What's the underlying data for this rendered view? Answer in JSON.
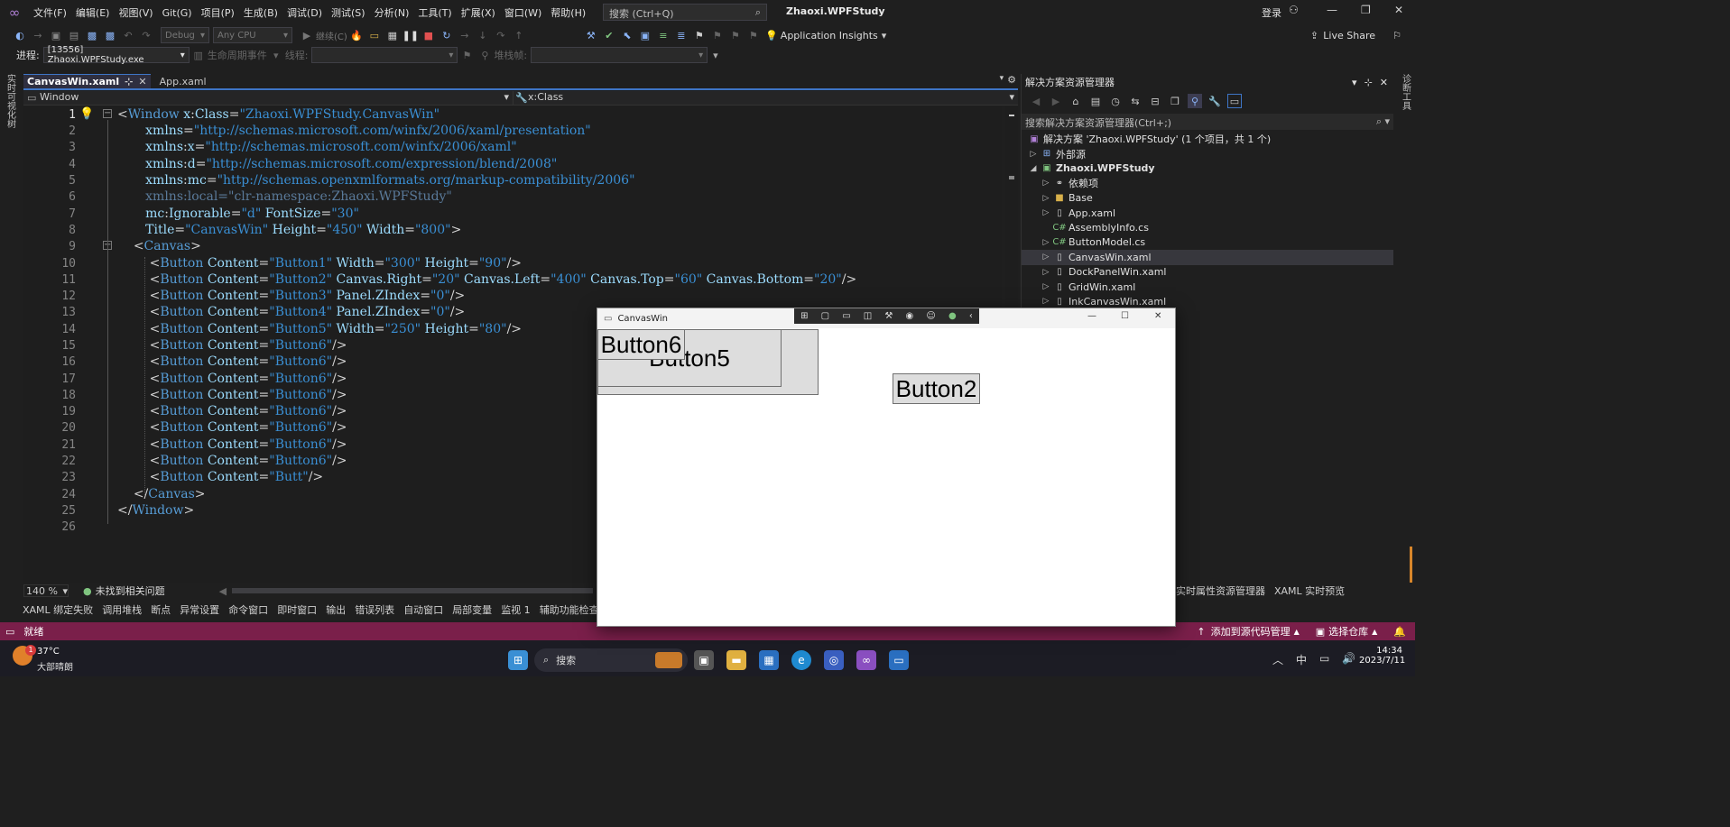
{
  "menubar": {
    "items": [
      "文件(F)",
      "编辑(E)",
      "视图(V)",
      "Git(G)",
      "项目(P)",
      "生成(B)",
      "调试(D)",
      "测试(S)",
      "分析(N)",
      "工具(T)",
      "扩展(X)",
      "窗口(W)",
      "帮助(H)"
    ],
    "search_placeholder": "搜索 (Ctrl+Q)",
    "app_title": "Zhaoxi.WPFStudy",
    "login": "登录"
  },
  "toolbar1": {
    "config": "Debug",
    "platform": "Any CPU",
    "continue": "继续(C)",
    "insights": "Application Insights",
    "live_share": "Live Share"
  },
  "toolbar2": {
    "process_label": "进程:",
    "process_value": "[13556] Zhaoxi.WPFStudy.exe",
    "lifecycle": "生命周期事件",
    "thread_label": "线程:",
    "stack_label": "堆栈帧:"
  },
  "tabs": {
    "active": "CanvasWin.xaml",
    "other": "App.xaml"
  },
  "navbar": {
    "left": "Window",
    "right": "x:Class"
  },
  "editor": {
    "line_numbers": [
      "1",
      "2",
      "3",
      "4",
      "5",
      "6",
      "7",
      "8",
      "9",
      "10",
      "11",
      "12",
      "13",
      "14",
      "15",
      "16",
      "17",
      "18",
      "19",
      "20",
      "21",
      "22",
      "23",
      "24",
      "25",
      "26"
    ],
    "zoom": "140 %",
    "issues": "未找到相关问题"
  },
  "solution": {
    "title": "解决方案资源管理器",
    "search_placeholder": "搜索解决方案资源管理器(Ctrl+;)",
    "root": "解决方案 'Zhaoxi.WPFStudy' (1 个项目，共 1 个)",
    "external": "外部源",
    "project": "Zhaoxi.WPFStudy",
    "items": [
      "依赖项",
      "Base",
      "App.xaml",
      "AssemblyInfo.cs",
      "ButtonModel.cs",
      "CanvasWin.xaml",
      "DockPanelWin.xaml",
      "GridWin.xaml",
      "InkCanvasWin.xaml"
    ]
  },
  "canvaswin": {
    "title": "CanvasWin",
    "button6": "Button6",
    "button5": "Button5",
    "button2": "Button2"
  },
  "tool_tabs": [
    "XAML 绑定失败",
    "调用堆栈",
    "断点",
    "异常设置",
    "命令窗口",
    "即时窗口",
    "输出",
    "错误列表",
    "自动窗口",
    "局部变量",
    "监视 1",
    "辅助功能检查器"
  ],
  "right_bottom_tabs": [
    "实时属性资源管理器",
    "XAML 实时预览"
  ],
  "left_rail": "实时可视化树",
  "right_rail": "诊断工具",
  "statusbar": {
    "ready": "就绪",
    "add_source": "添加到源代码管理",
    "select_repo": "选择仓库"
  },
  "taskbar": {
    "temp": "37°C",
    "weather": "大部晴朗",
    "badge": "1",
    "search": "搜索",
    "ime": "中",
    "time": "14:34",
    "date": "2023/7/11"
  }
}
